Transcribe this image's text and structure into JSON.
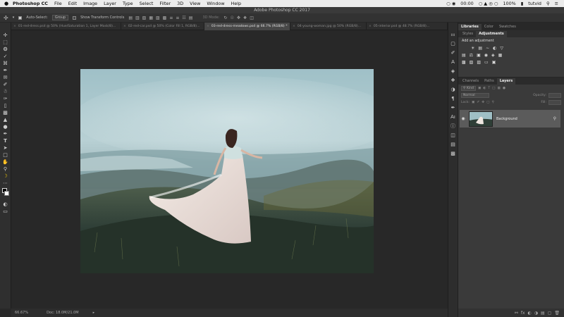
{
  "menubar": {
    "apple": "",
    "app_name": "Photoshop CC",
    "menus": [
      "File",
      "Edit",
      "Image",
      "Layer",
      "Type",
      "Select",
      "Filter",
      "3D",
      "View",
      "Window",
      "Help"
    ],
    "time": "00:00",
    "battery": "100%",
    "user": "tutvid"
  },
  "window": {
    "title": "Adobe Photoshop CC 2017"
  },
  "options": {
    "auto_select_label": "Auto-Select:",
    "auto_select_value": "Group",
    "transform_label": "Show Transform Controls",
    "mode_3d": "3D Mode:"
  },
  "tabs": [
    {
      "label": "01-red-dress.psd @ 50% (Hue/Saturation 1, Layer Mask/8)...",
      "active": false
    },
    {
      "label": "02-red-car.psd @ 50% (Color Fill 1, RGB/8)...",
      "active": false
    },
    {
      "label": "03-red-dress-meadows.psd @ 66.7% (RGB/8) *",
      "active": true
    },
    {
      "label": "04-young-woman.jpg @ 50% (RGB/8)...",
      "active": false
    },
    {
      "label": "05-interior.psd @ 48.7% (RGB/8)...",
      "active": false
    }
  ],
  "tools": [
    "move-tool",
    "artboard-tool",
    "lasso-tool",
    "quick-select-tool",
    "crop-tool",
    "eyedropper-tool",
    "healing-brush-tool",
    "brush-tool",
    "clone-stamp-tool",
    "history-brush-tool",
    "eraser-tool",
    "gradient-tool",
    "blur-tool",
    "dodge-tool",
    "pen-tool",
    "type-tool",
    "path-select-tool",
    "shape-tool",
    "hand-tool",
    "zoom-tool",
    "extra-tool"
  ],
  "status": {
    "zoom": "66.67%",
    "doc": "Doc: 18.0M/21.0M"
  },
  "panels": {
    "top_tabs": [
      "Libraries",
      "Color",
      "Swatches"
    ],
    "sub_tabs": [
      "Styles",
      "Adjustments"
    ],
    "adjust_header": "Add an adjustment",
    "layer_tabs": [
      "Channels",
      "Paths",
      "Layers"
    ],
    "kind_label": "Kind",
    "blend_mode": "Normal",
    "opacity_label": "Opacity:",
    "lock_label": "Lock:",
    "fill_label": "Fill:",
    "layer_name": "Background"
  },
  "colors": {
    "accent": "#5b5b5b",
    "foreground": "#000000",
    "background": "#ffffff"
  }
}
